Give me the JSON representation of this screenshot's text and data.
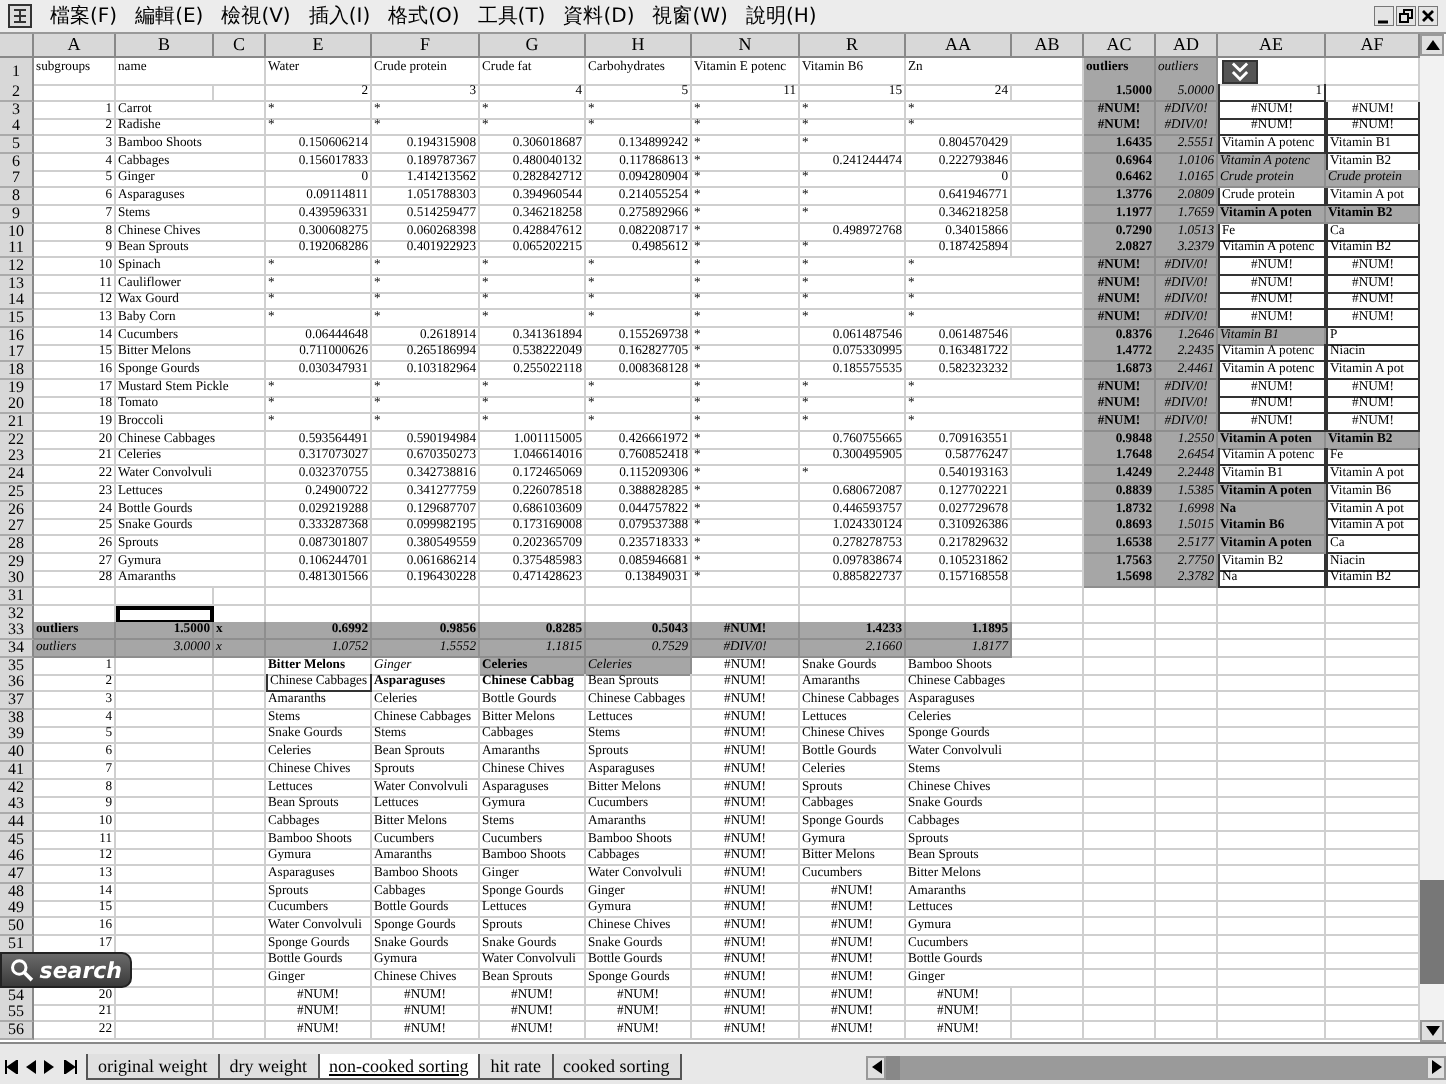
{
  "menu": [
    "檔案(F)",
    "編輯(E)",
    "檢視(V)",
    "插入(I)",
    "格式(O)",
    "工具(T)",
    "資料(D)",
    "視窗(W)",
    "說明(H)"
  ],
  "columns": [
    {
      "letter": "A"
    },
    {
      "letter": "B"
    },
    {
      "letter": "C"
    },
    {
      "letter": "E"
    },
    {
      "letter": "F"
    },
    {
      "letter": "G"
    },
    {
      "letter": "H"
    },
    {
      "letter": "N"
    },
    {
      "letter": "R"
    },
    {
      "letter": "AA"
    },
    {
      "letter": "AB"
    },
    {
      "letter": "AC"
    },
    {
      "letter": "AD"
    },
    {
      "letter": "AE"
    },
    {
      "letter": "AF"
    }
  ],
  "rows": [
    {
      "n": "1",
      "cells": [
        "subgroups",
        "name",
        null,
        "Water",
        "Crude protein",
        "Crude fat",
        "Carbohydrates",
        "Vitamin E potenc",
        "Vitamin B6",
        "Zn",
        null,
        {
          "t": "outliers",
          "kind": "label"
        },
        {
          "t": "outliers",
          "kind": "note"
        },
        null,
        null
      ]
    },
    {
      "n": "2",
      "cells": [
        null,
        null,
        null,
        {
          "t": "2",
          "kind": "number"
        },
        {
          "t": "3",
          "kind": "number"
        },
        {
          "t": "4",
          "kind": "number"
        },
        {
          "t": "5",
          "kind": "number"
        },
        {
          "t": "11",
          "kind": "number"
        },
        {
          "t": "15",
          "kind": "number"
        },
        {
          "t": "24",
          "kind": "number"
        },
        null,
        {
          "t": "1.5000",
          "kind": "outlier"
        },
        {
          "t": "5.0000",
          "kind": "ratio"
        },
        {
          "t": "1",
          "kind": "boxednumber"
        },
        null
      ]
    },
    {
      "n": "3",
      "cells": [
        {
          "t": "1",
          "kind": "number"
        },
        "Carrot",
        null,
        "*",
        "*",
        "*",
        "*",
        "*",
        "*",
        "*",
        null,
        {
          "t": "#NUM!",
          "kind": "outliererror"
        },
        {
          "t": "#DIV/0!",
          "kind": "ratioerror"
        },
        {
          "t": "#NUM!",
          "kind": "boxederror"
        },
        {
          "t": "#NUM!",
          "kind": "boxederror"
        }
      ]
    },
    {
      "n": "4",
      "cells": [
        {
          "t": "2",
          "kind": "number"
        },
        "Radishe",
        null,
        "*",
        "*",
        "*",
        "*",
        "*",
        "*",
        "*",
        null,
        {
          "t": "#NUM!",
          "kind": "outliererror"
        },
        {
          "t": "#DIV/0!",
          "kind": "ratioerror"
        },
        {
          "t": "#NUM!",
          "kind": "boxederror"
        },
        {
          "t": "#NUM!",
          "kind": "boxederror"
        }
      ]
    },
    {
      "n": "5",
      "cells": [
        {
          "t": "3",
          "kind": "number"
        },
        "Bamboo Shoots",
        null,
        {
          "t": "0.150606214",
          "kind": "number"
        },
        {
          "t": "0.194315908",
          "kind": "number"
        },
        {
          "t": "0.306018687",
          "kind": "number"
        },
        {
          "t": "0.134899242",
          "kind": "number"
        },
        "*",
        "*",
        {
          "t": "0.804570429",
          "kind": "number"
        },
        null,
        {
          "t": "1.6435",
          "kind": "outlier"
        },
        {
          "t": "2.5551",
          "kind": "ratio"
        },
        {
          "t": "Vitamin A potenc",
          "kind": "boxed"
        },
        {
          "t": "Vitamin B1",
          "kind": "boxed"
        }
      ]
    },
    {
      "n": "6",
      "cells": [
        {
          "t": "4",
          "kind": "number"
        },
        "Cabbages",
        null,
        {
          "t": "0.156017833",
          "kind": "number"
        },
        {
          "t": "0.189787367",
          "kind": "number"
        },
        {
          "t": "0.480040132",
          "kind": "number"
        },
        {
          "t": "0.117868613",
          "kind": "number"
        },
        "*",
        {
          "t": "0.241244474",
          "kind": "number"
        },
        {
          "t": "0.222793846",
          "kind": "number"
        },
        null,
        {
          "t": "0.6964",
          "kind": "outlier"
        },
        {
          "t": "1.0106",
          "kind": "ratio"
        },
        {
          "t": "Vitamin A potenc",
          "kind": "note"
        },
        {
          "t": "Vitamin B2",
          "kind": "boxed"
        }
      ]
    },
    {
      "n": "7",
      "cells": [
        {
          "t": "5",
          "kind": "number"
        },
        "Ginger",
        null,
        {
          "t": "0",
          "kind": "number"
        },
        {
          "t": "1.414213562",
          "kind": "number"
        },
        {
          "t": "0.282842712",
          "kind": "number"
        },
        {
          "t": "0.094280904",
          "kind": "number"
        },
        "*",
        "*",
        {
          "t": "0",
          "kind": "number"
        },
        null,
        {
          "t": "0.6462",
          "kind": "outlier"
        },
        {
          "t": "1.0165",
          "kind": "ratio"
        },
        {
          "t": "Crude protein",
          "kind": "note"
        },
        {
          "t": "Crude protein",
          "kind": "note"
        }
      ]
    },
    {
      "n": "8",
      "cells": [
        {
          "t": "6",
          "kind": "number"
        },
        "Asparaguses",
        null,
        {
          "t": "0.09114811",
          "kind": "number"
        },
        {
          "t": "1.051788303",
          "kind": "number"
        },
        {
          "t": "0.394960544",
          "kind": "number"
        },
        {
          "t": "0.214055254",
          "kind": "number"
        },
        "*",
        "*",
        {
          "t": "0.641946771",
          "kind": "number"
        },
        null,
        {
          "t": "1.3776",
          "kind": "outlier"
        },
        {
          "t": "2.0809",
          "kind": "ratio"
        },
        {
          "t": "Crude protein",
          "kind": "boxed"
        },
        {
          "t": "Vitamin A pot",
          "kind": "boxed"
        }
      ]
    },
    {
      "n": "9",
      "cells": [
        {
          "t": "7",
          "kind": "number"
        },
        "Stems",
        null,
        {
          "t": "0.439596331",
          "kind": "number"
        },
        {
          "t": "0.514259477",
          "kind": "number"
        },
        {
          "t": "0.346218258",
          "kind": "number"
        },
        {
          "t": "0.275892966",
          "kind": "number"
        },
        "*",
        "*",
        {
          "t": "0.346218258",
          "kind": "number"
        },
        null,
        {
          "t": "1.1977",
          "kind": "outlier"
        },
        {
          "t": "1.7659",
          "kind": "ratio"
        },
        {
          "t": "Vitamin A poten",
          "kind": "label"
        },
        {
          "t": "Vitamin B2",
          "kind": "label"
        }
      ]
    },
    {
      "n": "10",
      "cells": [
        {
          "t": "8",
          "kind": "number"
        },
        "Chinese Chives",
        null,
        {
          "t": "0.300608275",
          "kind": "number"
        },
        {
          "t": "0.060268398",
          "kind": "number"
        },
        {
          "t": "0.428847612",
          "kind": "number"
        },
        {
          "t": "0.082208717",
          "kind": "number"
        },
        "*",
        {
          "t": "0.498972768",
          "kind": "number"
        },
        {
          "t": "0.34015866",
          "kind": "number"
        },
        null,
        {
          "t": "0.7290",
          "kind": "outlier"
        },
        {
          "t": "1.0513",
          "kind": "ratio"
        },
        {
          "t": "Fe",
          "kind": "boxed"
        },
        {
          "t": "Ca",
          "kind": "boxed"
        }
      ]
    },
    {
      "n": "11",
      "cells": [
        {
          "t": "9",
          "kind": "number"
        },
        "Bean Sprouts",
        null,
        {
          "t": "0.192068286",
          "kind": "number"
        },
        {
          "t": "0.401922923",
          "kind": "number"
        },
        {
          "t": "0.065202215",
          "kind": "number"
        },
        {
          "t": "0.4985612",
          "kind": "number"
        },
        "*",
        "*",
        {
          "t": "0.187425894",
          "kind": "number"
        },
        null,
        {
          "t": "2.0827",
          "kind": "outlier"
        },
        {
          "t": "3.2379",
          "kind": "ratio"
        },
        {
          "t": "Vitamin A potenc",
          "kind": "boxed"
        },
        {
          "t": "Vitamin B2",
          "kind": "boxed"
        }
      ]
    },
    {
      "n": "12",
      "cells": [
        {
          "t": "10",
          "kind": "number"
        },
        "Spinach",
        null,
        "*",
        "*",
        "*",
        "*",
        "*",
        "*",
        "*",
        null,
        {
          "t": "#NUM!",
          "kind": "outliererror"
        },
        {
          "t": "#DIV/0!",
          "kind": "ratioerror"
        },
        {
          "t": "#NUM!",
          "kind": "boxederror"
        },
        {
          "t": "#NUM!",
          "kind": "boxederror"
        }
      ]
    },
    {
      "n": "13",
      "cells": [
        {
          "t": "11",
          "kind": "number"
        },
        "Cauliflower",
        null,
        "*",
        "*",
        "*",
        "*",
        "*",
        "*",
        "*",
        null,
        {
          "t": "#NUM!",
          "kind": "outliererror"
        },
        {
          "t": "#DIV/0!",
          "kind": "ratioerror"
        },
        {
          "t": "#NUM!",
          "kind": "boxederror"
        },
        {
          "t": "#NUM!",
          "kind": "boxederror"
        }
      ]
    },
    {
      "n": "14",
      "cells": [
        {
          "t": "12",
          "kind": "number"
        },
        "Wax Gourd",
        null,
        "*",
        "*",
        "*",
        "*",
        "*",
        "*",
        "*",
        null,
        {
          "t": "#NUM!",
          "kind": "outliererror"
        },
        {
          "t": "#DIV/0!",
          "kind": "ratioerror"
        },
        {
          "t": "#NUM!",
          "kind": "boxederror"
        },
        {
          "t": "#NUM!",
          "kind": "boxederror"
        }
      ]
    },
    {
      "n": "15",
      "cells": [
        {
          "t": "13",
          "kind": "number"
        },
        "Baby Corn",
        null,
        "*",
        "*",
        "*",
        "*",
        "*",
        "*",
        "*",
        null,
        {
          "t": "#NUM!",
          "kind": "outliererror"
        },
        {
          "t": "#DIV/0!",
          "kind": "ratioerror"
        },
        {
          "t": "#NUM!",
          "kind": "boxederror"
        },
        {
          "t": "#NUM!",
          "kind": "boxederror"
        }
      ]
    },
    {
      "n": "16",
      "cells": [
        {
          "t": "14",
          "kind": "number"
        },
        "Cucumbers",
        null,
        {
          "t": "0.06444648",
          "kind": "number"
        },
        {
          "t": "0.2618914",
          "kind": "number"
        },
        {
          "t": "0.341361894",
          "kind": "number"
        },
        {
          "t": "0.155269738",
          "kind": "number"
        },
        "*",
        {
          "t": "0.061487546",
          "kind": "number"
        },
        {
          "t": "0.061487546",
          "kind": "number"
        },
        null,
        {
          "t": "0.8376",
          "kind": "outlier"
        },
        {
          "t": "1.2646",
          "kind": "ratio"
        },
        {
          "t": "Vitamin B1",
          "kind": "note"
        },
        {
          "t": "P",
          "kind": "boxed"
        }
      ]
    },
    {
      "n": "17",
      "cells": [
        {
          "t": "15",
          "kind": "number"
        },
        "Bitter Melons",
        null,
        {
          "t": "0.711000626",
          "kind": "number"
        },
        {
          "t": "0.265186994",
          "kind": "number"
        },
        {
          "t": "0.538222049",
          "kind": "number"
        },
        {
          "t": "0.162827705",
          "kind": "number"
        },
        "*",
        {
          "t": "0.075330995",
          "kind": "number"
        },
        {
          "t": "0.163481722",
          "kind": "number"
        },
        null,
        {
          "t": "1.4772",
          "kind": "outlier"
        },
        {
          "t": "2.2435",
          "kind": "ratio"
        },
        {
          "t": "Vitamin A potenc",
          "kind": "boxed"
        },
        {
          "t": "Niacin",
          "kind": "boxed"
        }
      ]
    },
    {
      "n": "18",
      "cells": [
        {
          "t": "16",
          "kind": "number"
        },
        "Sponge Gourds",
        null,
        {
          "t": "0.030347931",
          "kind": "number"
        },
        {
          "t": "0.103182964",
          "kind": "number"
        },
        {
          "t": "0.255022118",
          "kind": "number"
        },
        {
          "t": "0.008368128",
          "kind": "number"
        },
        "*",
        {
          "t": "0.185575535",
          "kind": "number"
        },
        {
          "t": "0.582323232",
          "kind": "number"
        },
        null,
        {
          "t": "1.6873",
          "kind": "outlier"
        },
        {
          "t": "2.4461",
          "kind": "ratio"
        },
        {
          "t": "Vitamin A potenc",
          "kind": "boxed"
        },
        {
          "t": "Vitamin A pot",
          "kind": "boxed"
        }
      ]
    },
    {
      "n": "19",
      "cells": [
        {
          "t": "17",
          "kind": "number"
        },
        "Mustard Stem Pickle",
        null,
        "*",
        "*",
        "*",
        "*",
        "*",
        "*",
        "*",
        null,
        {
          "t": "#NUM!",
          "kind": "outliererror"
        },
        {
          "t": "#DIV/0!",
          "kind": "ratioerror"
        },
        {
          "t": "#NUM!",
          "kind": "boxederror"
        },
        {
          "t": "#NUM!",
          "kind": "boxederror"
        }
      ]
    },
    {
      "n": "20",
      "cells": [
        {
          "t": "18",
          "kind": "number"
        },
        "Tomato",
        null,
        "*",
        "*",
        "*",
        "*",
        "*",
        "*",
        "*",
        null,
        {
          "t": "#NUM!",
          "kind": "outliererror"
        },
        {
          "t": "#DIV/0!",
          "kind": "ratioerror"
        },
        {
          "t": "#NUM!",
          "kind": "boxederror"
        },
        {
          "t": "#NUM!",
          "kind": "boxederror"
        }
      ]
    },
    {
      "n": "21",
      "cells": [
        {
          "t": "19",
          "kind": "number"
        },
        "Broccoli",
        null,
        "*",
        "*",
        "*",
        "*",
        "*",
        "*",
        "*",
        null,
        {
          "t": "#NUM!",
          "kind": "outliererror"
        },
        {
          "t": "#DIV/0!",
          "kind": "ratioerror"
        },
        {
          "t": "#NUM!",
          "kind": "boxederror"
        },
        {
          "t": "#NUM!",
          "kind": "boxederror"
        }
      ]
    },
    {
      "n": "22",
      "cells": [
        {
          "t": "20",
          "kind": "number"
        },
        "Chinese Cabbages",
        null,
        {
          "t": "0.593564491",
          "kind": "number"
        },
        {
          "t": "0.590194984",
          "kind": "number"
        },
        {
          "t": "1.001115005",
          "kind": "number"
        },
        {
          "t": "0.426661972",
          "kind": "number"
        },
        "*",
        {
          "t": "0.760755665",
          "kind": "number"
        },
        {
          "t": "0.709163551",
          "kind": "number"
        },
        null,
        {
          "t": "0.9848",
          "kind": "outlier"
        },
        {
          "t": "1.2550",
          "kind": "ratio"
        },
        {
          "t": "Vitamin A poten",
          "kind": "label"
        },
        {
          "t": "Vitamin B2",
          "kind": "label"
        }
      ]
    },
    {
      "n": "23",
      "cells": [
        {
          "t": "21",
          "kind": "number"
        },
        "Celeries",
        null,
        {
          "t": "0.317073027",
          "kind": "number"
        },
        {
          "t": "0.670350273",
          "kind": "number"
        },
        {
          "t": "1.046614016",
          "kind": "number"
        },
        {
          "t": "0.760852418",
          "kind": "number"
        },
        "*",
        {
          "t": "0.300495905",
          "kind": "number"
        },
        {
          "t": "0.58776247",
          "kind": "number"
        },
        null,
        {
          "t": "1.7648",
          "kind": "outlier"
        },
        {
          "t": "2.6454",
          "kind": "ratio"
        },
        {
          "t": "Vitamin A potenc",
          "kind": "boxed"
        },
        {
          "t": "Fe",
          "kind": "boxed"
        }
      ]
    },
    {
      "n": "24",
      "cells": [
        {
          "t": "22",
          "kind": "number"
        },
        "Water Convolvuli",
        null,
        {
          "t": "0.032370755",
          "kind": "number"
        },
        {
          "t": "0.342738816",
          "kind": "number"
        },
        {
          "t": "0.172465069",
          "kind": "number"
        },
        {
          "t": "0.115209306",
          "kind": "number"
        },
        "*",
        "*",
        {
          "t": "0.540193163",
          "kind": "number"
        },
        null,
        {
          "t": "1.4249",
          "kind": "outlier"
        },
        {
          "t": "2.2448",
          "kind": "ratio"
        },
        {
          "t": "Vitamin B1",
          "kind": "boxed"
        },
        {
          "t": "Vitamin A pot",
          "kind": "boxed"
        }
      ]
    },
    {
      "n": "25",
      "cells": [
        {
          "t": "23",
          "kind": "number"
        },
        "Lettuces",
        null,
        {
          "t": "0.24900722",
          "kind": "number"
        },
        {
          "t": "0.341277759",
          "kind": "number"
        },
        {
          "t": "0.226078518",
          "kind": "number"
        },
        {
          "t": "0.388828285",
          "kind": "number"
        },
        "*",
        {
          "t": "0.680672087",
          "kind": "number"
        },
        {
          "t": "0.127702221",
          "kind": "number"
        },
        null,
        {
          "t": "0.8839",
          "kind": "outlier"
        },
        {
          "t": "1.5385",
          "kind": "ratio"
        },
        {
          "t": "Vitamin A poten",
          "kind": "label"
        },
        {
          "t": "Vitamin B6",
          "kind": "boxed"
        }
      ]
    },
    {
      "n": "26",
      "cells": [
        {
          "t": "24",
          "kind": "number"
        },
        "Bottle Gourds",
        null,
        {
          "t": "0.029219288",
          "kind": "number"
        },
        {
          "t": "0.129687707",
          "kind": "number"
        },
        {
          "t": "0.686103609",
          "kind": "number"
        },
        {
          "t": "0.044757822",
          "kind": "number"
        },
        "*",
        {
          "t": "0.446593757",
          "kind": "number"
        },
        {
          "t": "0.027729678",
          "kind": "number"
        },
        null,
        {
          "t": "1.8732",
          "kind": "outlier"
        },
        {
          "t": "1.6998",
          "kind": "ratio"
        },
        {
          "t": "Na",
          "kind": "label"
        },
        {
          "t": "Vitamin A pot",
          "kind": "boxed"
        }
      ]
    },
    {
      "n": "27",
      "cells": [
        {
          "t": "25",
          "kind": "number"
        },
        "Snake Gourds",
        null,
        {
          "t": "0.333287368",
          "kind": "number"
        },
        {
          "t": "0.099982195",
          "kind": "number"
        },
        {
          "t": "0.173169008",
          "kind": "number"
        },
        {
          "t": "0.079537388",
          "kind": "number"
        },
        "*",
        {
          "t": "1.024330124",
          "kind": "number"
        },
        {
          "t": "0.310926386",
          "kind": "number"
        },
        null,
        {
          "t": "0.8693",
          "kind": "outlier"
        },
        {
          "t": "1.5015",
          "kind": "ratio"
        },
        {
          "t": "Vitamin B6",
          "kind": "label"
        },
        {
          "t": "Vitamin A pot",
          "kind": "boxed"
        }
      ]
    },
    {
      "n": "28",
      "cells": [
        {
          "t": "26",
          "kind": "number"
        },
        "Sprouts",
        null,
        {
          "t": "0.087301807",
          "kind": "number"
        },
        {
          "t": "0.380549559",
          "kind": "number"
        },
        {
          "t": "0.202365709",
          "kind": "number"
        },
        {
          "t": "0.235718333",
          "kind": "number"
        },
        "*",
        {
          "t": "0.278278753",
          "kind": "number"
        },
        {
          "t": "0.217829632",
          "kind": "number"
        },
        null,
        {
          "t": "1.6538",
          "kind": "outlier"
        },
        {
          "t": "2.5177",
          "kind": "ratio"
        },
        {
          "t": "Vitamin A poten",
          "kind": "label"
        },
        {
          "t": "Ca",
          "kind": "boxed"
        }
      ]
    },
    {
      "n": "29",
      "cells": [
        {
          "t": "27",
          "kind": "number"
        },
        "Gymura",
        null,
        {
          "t": "0.106244701",
          "kind": "number"
        },
        {
          "t": "0.061686214",
          "kind": "number"
        },
        {
          "t": "0.375485983",
          "kind": "number"
        },
        {
          "t": "0.085946681",
          "kind": "number"
        },
        "*",
        {
          "t": "0.097838674",
          "kind": "number"
        },
        {
          "t": "0.105231862",
          "kind": "number"
        },
        null,
        {
          "t": "1.7563",
          "kind": "outlier"
        },
        {
          "t": "2.7750",
          "kind": "ratio"
        },
        {
          "t": "Vitamin B2",
          "kind": "boxed"
        },
        {
          "t": "Niacin",
          "kind": "boxed"
        }
      ]
    },
    {
      "n": "30",
      "cells": [
        {
          "t": "28",
          "kind": "number"
        },
        "Amaranths",
        null,
        {
          "t": "0.481301566",
          "kind": "number"
        },
        {
          "t": "0.196430228",
          "kind": "number"
        },
        {
          "t": "0.471428623",
          "kind": "number"
        },
        {
          "t": "0.13849031",
          "kind": "number"
        },
        "*",
        {
          "t": "0.885822737",
          "kind": "number"
        },
        {
          "t": "0.157168558",
          "kind": "number"
        },
        null,
        {
          "t": "1.5698",
          "kind": "outlier"
        },
        {
          "t": "2.3782",
          "kind": "ratio"
        },
        {
          "t": "Na",
          "kind": "boxed"
        },
        {
          "t": "Vitamin B2",
          "kind": "boxed"
        }
      ]
    },
    {
      "n": "31",
      "cells": [
        null,
        null,
        null,
        null,
        null,
        null,
        null,
        null,
        null,
        null,
        null,
        null,
        null,
        null,
        null
      ]
    },
    {
      "n": "32",
      "cells": [
        null,
        {
          "kind": "active"
        },
        null,
        null,
        null,
        null,
        null,
        null,
        null,
        null,
        null,
        null,
        null,
        null,
        null
      ]
    },
    {
      "n": "33",
      "cells": [
        {
          "t": "outliers",
          "kind": "label"
        },
        {
          "t": "1.5000",
          "kind": "outlier"
        },
        {
          "t": "x",
          "kind": "label"
        },
        {
          "t": "0.6992",
          "kind": "outlier"
        },
        {
          "t": "0.9856",
          "kind": "outlier"
        },
        {
          "t": "0.8285",
          "kind": "outlier"
        },
        {
          "t": "0.5043",
          "kind": "outlier"
        },
        {
          "t": "#NUM!",
          "kind": "outliererror"
        },
        {
          "t": "1.4233",
          "kind": "outlier"
        },
        {
          "t": "1.1895",
          "kind": "outlier"
        },
        null,
        null,
        null,
        null,
        null
      ]
    },
    {
      "n": "34",
      "cells": [
        {
          "t": "outliers",
          "kind": "note"
        },
        {
          "t": "3.0000",
          "kind": "ratio"
        },
        {
          "t": "x",
          "kind": "note"
        },
        {
          "t": "1.0752",
          "kind": "ratio"
        },
        {
          "t": "1.5552",
          "kind": "ratio"
        },
        {
          "t": "1.1815",
          "kind": "ratio"
        },
        {
          "t": "0.7529",
          "kind": "ratio"
        },
        {
          "t": "#DIV/0!",
          "kind": "ratioerror"
        },
        {
          "t": "2.1660",
          "kind": "ratio"
        },
        {
          "t": "1.8177",
          "kind": "ratio"
        },
        null,
        null,
        null,
        null,
        null
      ]
    },
    {
      "n": "35",
      "cells": [
        {
          "t": "1",
          "kind": "number"
        },
        null,
        null,
        {
          "t": "Bitter Melons",
          "kind": "bold"
        },
        {
          "t": "Ginger",
          "kind": "italic"
        },
        {
          "t": "Celeries",
          "kind": "label"
        },
        {
          "t": "Celeries",
          "kind": "note"
        },
        {
          "t": "#NUM!",
          "kind": "error"
        },
        "Snake Gourds",
        "Bamboo Shoots",
        null,
        null,
        null,
        null,
        null
      ]
    },
    {
      "n": "36",
      "cells": [
        {
          "t": "2",
          "kind": "number"
        },
        null,
        null,
        {
          "t": "Chinese Cabbages",
          "kind": "boxed"
        },
        {
          "t": "Asparaguses",
          "kind": "bold"
        },
        {
          "t": "Chinese Cabbag",
          "kind": "bold"
        },
        "Bean Sprouts",
        {
          "t": "#NUM!",
          "kind": "error"
        },
        "Amaranths",
        "Chinese Cabbages",
        null,
        null,
        null,
        null,
        null
      ]
    },
    {
      "n": "37",
      "cells": [
        {
          "t": "3",
          "kind": "number"
        },
        null,
        null,
        "Amaranths",
        "Celeries",
        "Bottle Gourds",
        "Chinese Cabbages",
        {
          "t": "#NUM!",
          "kind": "error"
        },
        "Chinese Cabbages",
        "Asparaguses",
        null,
        null,
        null,
        null,
        null
      ]
    },
    {
      "n": "38",
      "cells": [
        {
          "t": "4",
          "kind": "number"
        },
        null,
        null,
        "Stems",
        "Chinese Cabbages",
        "Bitter Melons",
        "Lettuces",
        {
          "t": "#NUM!",
          "kind": "error"
        },
        "Lettuces",
        "Celeries",
        null,
        null,
        null,
        null,
        null
      ]
    },
    {
      "n": "39",
      "cells": [
        {
          "t": "5",
          "kind": "number"
        },
        null,
        null,
        "Snake Gourds",
        "Stems",
        "Cabbages",
        "Stems",
        {
          "t": "#NUM!",
          "kind": "error"
        },
        "Chinese Chives",
        "Sponge Gourds",
        null,
        null,
        null,
        null,
        null
      ]
    },
    {
      "n": "40",
      "cells": [
        {
          "t": "6",
          "kind": "number"
        },
        null,
        null,
        "Celeries",
        "Bean Sprouts",
        "Amaranths",
        "Sprouts",
        {
          "t": "#NUM!",
          "kind": "error"
        },
        "Bottle Gourds",
        "Water Convolvuli",
        null,
        null,
        null,
        null,
        null
      ]
    },
    {
      "n": "41",
      "cells": [
        {
          "t": "7",
          "kind": "number"
        },
        null,
        null,
        "Chinese Chives",
        "Sprouts",
        "Chinese Chives",
        "Asparaguses",
        {
          "t": "#NUM!",
          "kind": "error"
        },
        "Celeries",
        "Stems",
        null,
        null,
        null,
        null,
        null
      ]
    },
    {
      "n": "42",
      "cells": [
        {
          "t": "8",
          "kind": "number"
        },
        null,
        null,
        "Lettuces",
        "Water Convolvuli",
        "Asparaguses",
        "Bitter Melons",
        {
          "t": "#NUM!",
          "kind": "error"
        },
        "Sprouts",
        "Chinese Chives",
        null,
        null,
        null,
        null,
        null
      ]
    },
    {
      "n": "43",
      "cells": [
        {
          "t": "9",
          "kind": "number"
        },
        null,
        null,
        "Bean Sprouts",
        "Lettuces",
        "Gymura",
        "Cucumbers",
        {
          "t": "#NUM!",
          "kind": "error"
        },
        "Cabbages",
        "Snake Gourds",
        null,
        null,
        null,
        null,
        null
      ]
    },
    {
      "n": "44",
      "cells": [
        {
          "t": "10",
          "kind": "number"
        },
        null,
        null,
        "Cabbages",
        "Bitter Melons",
        "Stems",
        "Amaranths",
        {
          "t": "#NUM!",
          "kind": "error"
        },
        "Sponge Gourds",
        "Cabbages",
        null,
        null,
        null,
        null,
        null
      ]
    },
    {
      "n": "45",
      "cells": [
        {
          "t": "11",
          "kind": "number"
        },
        null,
        null,
        "Bamboo Shoots",
        "Cucumbers",
        "Cucumbers",
        "Bamboo Shoots",
        {
          "t": "#NUM!",
          "kind": "error"
        },
        "Gymura",
        "Sprouts",
        null,
        null,
        null,
        null,
        null
      ]
    },
    {
      "n": "46",
      "cells": [
        {
          "t": "12",
          "kind": "number"
        },
        null,
        null,
        "Gymura",
        "Amaranths",
        "Bamboo Shoots",
        "Cabbages",
        {
          "t": "#NUM!",
          "kind": "error"
        },
        "Bitter Melons",
        "Bean Sprouts",
        null,
        null,
        null,
        null,
        null
      ]
    },
    {
      "n": "47",
      "cells": [
        {
          "t": "13",
          "kind": "number"
        },
        null,
        null,
        "Asparaguses",
        "Bamboo Shoots",
        "Ginger",
        "Water Convolvuli",
        {
          "t": "#NUM!",
          "kind": "error"
        },
        "Cucumbers",
        "Bitter Melons",
        null,
        null,
        null,
        null,
        null
      ]
    },
    {
      "n": "48",
      "cells": [
        {
          "t": "14",
          "kind": "number"
        },
        null,
        null,
        "Sprouts",
        "Cabbages",
        "Sponge Gourds",
        "Ginger",
        {
          "t": "#NUM!",
          "kind": "error"
        },
        {
          "t": "#NUM!",
          "kind": "error"
        },
        "Amaranths",
        null,
        null,
        null,
        null,
        null
      ]
    },
    {
      "n": "49",
      "cells": [
        {
          "t": "15",
          "kind": "number"
        },
        null,
        null,
        "Cucumbers",
        "Bottle Gourds",
        "Lettuces",
        "Gymura",
        {
          "t": "#NUM!",
          "kind": "error"
        },
        {
          "t": "#NUM!",
          "kind": "error"
        },
        "Lettuces",
        null,
        null,
        null,
        null,
        null
      ]
    },
    {
      "n": "50",
      "cells": [
        {
          "t": "16",
          "kind": "number"
        },
        null,
        null,
        "Water Convolvuli",
        "Sponge Gourds",
        "Sprouts",
        "Chinese Chives",
        {
          "t": "#NUM!",
          "kind": "error"
        },
        {
          "t": "#NUM!",
          "kind": "error"
        },
        "Gymura",
        null,
        null,
        null,
        null,
        null
      ]
    },
    {
      "n": "51",
      "cells": [
        {
          "t": "17",
          "kind": "number"
        },
        null,
        null,
        "Sponge Gourds",
        "Snake Gourds",
        "Snake Gourds",
        "Snake Gourds",
        {
          "t": "#NUM!",
          "kind": "error"
        },
        {
          "t": "#NUM!",
          "kind": "error"
        },
        "Cucumbers",
        null,
        null,
        null,
        null,
        null
      ]
    },
    {
      "cells": [
        null,
        null,
        null,
        "Bottle Gourds",
        "Gymura",
        "Water Convolvuli",
        "Bottle Gourds",
        {
          "t": "#NUM!",
          "kind": "error"
        },
        {
          "t": "#NUM!",
          "kind": "error"
        },
        "Bottle Gourds",
        null,
        null,
        null,
        null,
        null
      ]
    },
    {
      "cells": [
        null,
        null,
        null,
        "Ginger",
        "Chinese Chives",
        "Bean Sprouts",
        "Sponge Gourds",
        {
          "t": "#NUM!",
          "kind": "error"
        },
        {
          "t": "#NUM!",
          "kind": "error"
        },
        "Ginger",
        null,
        null,
        null,
        null,
        null
      ]
    },
    {
      "n": "54",
      "cells": [
        {
          "t": "20",
          "kind": "number"
        },
        null,
        null,
        {
          "t": "#NUM!",
          "kind": "error"
        },
        {
          "t": "#NUM!",
          "kind": "error"
        },
        {
          "t": "#NUM!",
          "kind": "error"
        },
        {
          "t": "#NUM!",
          "kind": "error"
        },
        {
          "t": "#NUM!",
          "kind": "error"
        },
        {
          "t": "#NUM!",
          "kind": "error"
        },
        {
          "t": "#NUM!",
          "kind": "error"
        },
        null,
        null,
        null,
        null,
        null
      ]
    },
    {
      "n": "55",
      "cells": [
        {
          "t": "21",
          "kind": "number"
        },
        null,
        null,
        {
          "t": "#NUM!",
          "kind": "error"
        },
        {
          "t": "#NUM!",
          "kind": "error"
        },
        {
          "t": "#NUM!",
          "kind": "error"
        },
        {
          "t": "#NUM!",
          "kind": "error"
        },
        {
          "t": "#NUM!",
          "kind": "error"
        },
        {
          "t": "#NUM!",
          "kind": "error"
        },
        {
          "t": "#NUM!",
          "kind": "error"
        },
        null,
        null,
        null,
        null,
        null
      ]
    },
    {
      "n": "56",
      "cells": [
        {
          "t": "22",
          "kind": "number"
        },
        null,
        null,
        {
          "t": "#NUM!",
          "kind": "error"
        },
        {
          "t": "#NUM!",
          "kind": "error"
        },
        {
          "t": "#NUM!",
          "kind": "error"
        },
        {
          "t": "#NUM!",
          "kind": "error"
        },
        {
          "t": "#NUM!",
          "kind": "error"
        },
        {
          "t": "#NUM!",
          "kind": "error"
        },
        {
          "t": "#NUM!",
          "kind": "error"
        },
        null,
        null,
        null,
        null,
        null
      ]
    }
  ],
  "tabs": [
    {
      "label": "original weight",
      "selected": false
    },
    {
      "label": "dry weight",
      "selected": false
    },
    {
      "label": "non-cooked sorting",
      "selected": true
    },
    {
      "label": "hit rate",
      "selected": false
    },
    {
      "label": "cooked sorting",
      "selected": false
    }
  ],
  "search_overlay": {
    "label": "search"
  }
}
